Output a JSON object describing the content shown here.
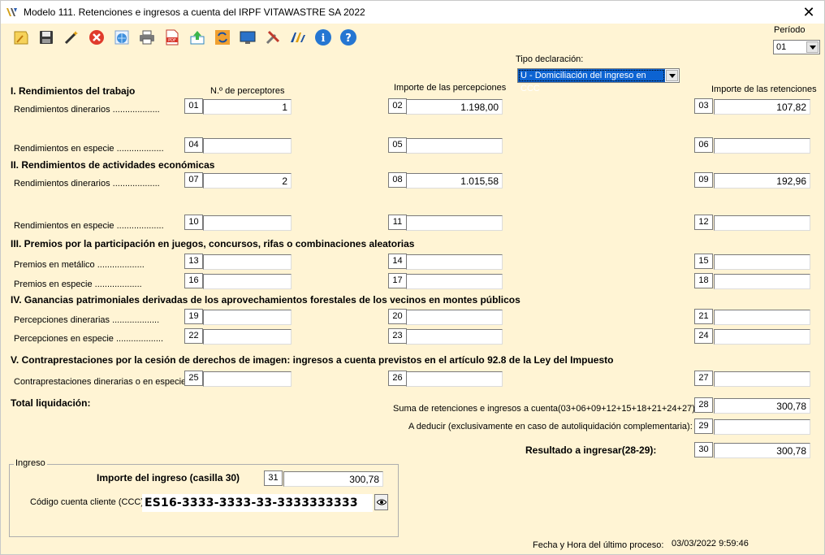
{
  "window": {
    "title": "Modelo 111. Retenciones e ingresos a cuenta del IRPF VITAWASTRE SA 2022",
    "close_glyph": "✕"
  },
  "toolbar": {
    "icons": [
      "notepad-icon",
      "floppy-save-icon",
      "magic-wand-icon",
      "delete-icon",
      "globe-icon",
      "printer-icon",
      "pdf-icon",
      "upload-icon",
      "sync-icon",
      "monitor-icon",
      "tools-icon",
      "aeat-logo-icon",
      "info-icon",
      "help-icon"
    ]
  },
  "periodo": {
    "label": "Período",
    "value": "01"
  },
  "tipo_declaracion": {
    "label": "Tipo declaración:",
    "value": "U - Domiciliación del ingreso en CCC"
  },
  "columns": {
    "perceptores": "N.º de perceptores",
    "percepciones": "Importe de las percepciones",
    "retenciones": "Importe de las retenciones"
  },
  "sections": {
    "s1": "I. Rendimientos del trabajo",
    "s2": "II. Rendimientos de actividades económicas",
    "s3": "III. Premios por la participación en juegos, concursos, rifas o combinaciones aleatorias",
    "s4": "IV. Ganancias patrimoniales derivadas de los aprovechamientos forestales de los vecinos en montes públicos",
    "s5": "V. Contraprestaciones por la cesión de derechos de imagen: ingresos a cuenta previstos en el artículo 92.8 de la Ley del Impuesto"
  },
  "rows": [
    {
      "label": "Rendimientos dinerarios ...................",
      "c1": "01",
      "v1": "1",
      "c2": "02",
      "v2": "1.198,00",
      "c3": "03",
      "v3": "107,82"
    },
    {
      "label": "Rendimientos en especie  ...................",
      "c1": "04",
      "v1": "",
      "c2": "05",
      "v2": "",
      "c3": "06",
      "v3": ""
    },
    {
      "label": "Rendimientos dinerarios  ...................",
      "c1": "07",
      "v1": "2",
      "c2": "08",
      "v2": "1.015,58",
      "c3": "09",
      "v3": "192,96"
    },
    {
      "label": "Rendimientos en especie ...................",
      "c1": "10",
      "v1": "",
      "c2": "11",
      "v2": "",
      "c3": "12",
      "v3": ""
    },
    {
      "label": "Premios en metálico ...................",
      "c1": "13",
      "v1": "",
      "c2": "14",
      "v2": "",
      "c3": "15",
      "v3": ""
    },
    {
      "label": "Premios en especie ...................",
      "c1": "16",
      "v1": "",
      "c2": "17",
      "v2": "",
      "c3": "18",
      "v3": ""
    },
    {
      "label": "Percepciones dinerarias ...................",
      "c1": "19",
      "v1": "",
      "c2": "20",
      "v2": "",
      "c3": "21",
      "v3": ""
    },
    {
      "label": "Percepciones en especie ...................",
      "c1": "22",
      "v1": "",
      "c2": "23",
      "v2": "",
      "c3": "24",
      "v3": ""
    },
    {
      "label": "Contraprestaciones dinerarias o en especie",
      "c1": "25",
      "v1": "",
      "c2": "26",
      "v2": "",
      "c3": "27",
      "v3": ""
    }
  ],
  "totals": {
    "title": "Total liquidación:",
    "suma_label": "Suma de retenciones e ingresos a cuenta(03+06+09+12+15+18+21+24+27)",
    "suma_code": "28",
    "suma_value": "300,78",
    "deducir_label": "A deducir (exclusivamente en caso de autoliquidación complementaria):",
    "deducir_code": "29",
    "deducir_value": "",
    "resultado_label": "Resultado a ingresar(28-29):",
    "resultado_code": "30",
    "resultado_value": "300,78"
  },
  "ingreso": {
    "legend": "Ingreso",
    "importe_label": "Importe del ingreso (casilla 30)",
    "importe_code": "31",
    "importe_value": "300,78",
    "ccc_label": "Código cuenta cliente (CCC)",
    "ccc_value": "ES16-3333-3333-33-3333333333"
  },
  "footer": {
    "label": "Fecha y Hora del último proceso:",
    "value": "03/03/2022 9:59:46"
  }
}
